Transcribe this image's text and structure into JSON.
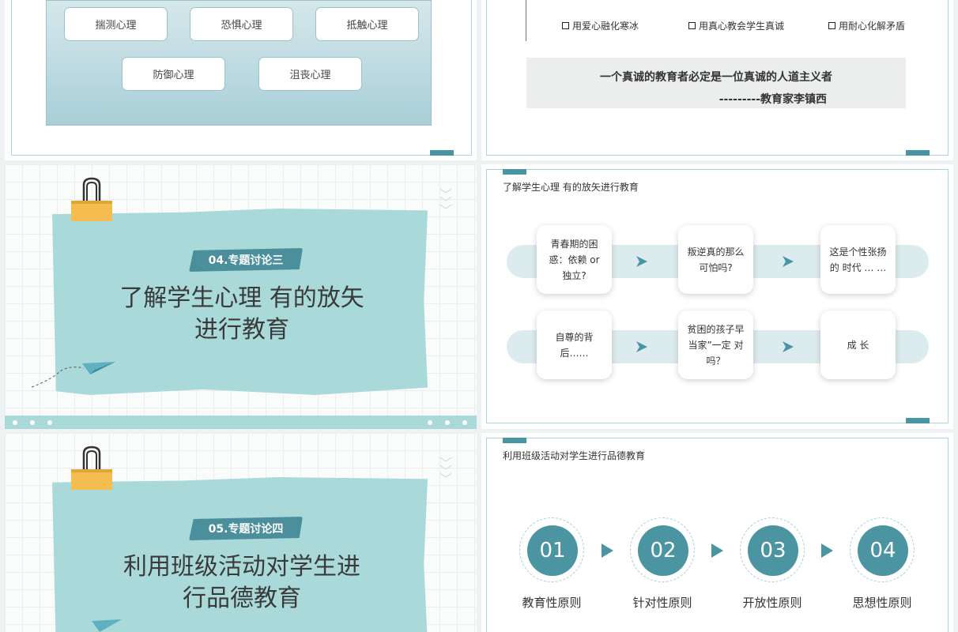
{
  "slide1": {
    "pills": [
      "揣测心理",
      "恐惧心理",
      "抵触心理",
      "防御心理",
      "沮丧心理"
    ]
  },
  "slide2": {
    "checks": [
      "用爱心融化寒冰",
      "用真心教会学生真诚",
      "用耐心化解矛盾"
    ],
    "quote_line1": "一个真诚的教育者必定是一位真诚的人道主义者",
    "quote_line2": "---------教育家李镇西"
  },
  "slide3": {
    "badge": "04.专题讨论三",
    "title_line1": "了解学生心理 有的放矢",
    "title_line2": "进行教育"
  },
  "slide4": {
    "label": "了解学生心理  有的放矢进行教育",
    "cards": [
      "青春期的困惑：依赖 or 独立?",
      "叛逆真的那么可怕吗?",
      "这是个性张扬 的 时代  …  …",
      "自尊的背后……",
      "贫困的孩子早当家”一定 对 吗？",
      "成  长"
    ]
  },
  "slide5": {
    "badge": "05.专题讨论四",
    "title_line1": "利用班级活动对学生进",
    "title_line2": "行品德教育"
  },
  "slide6": {
    "label": "利用班级活动对学生进行品德教育",
    "steps": [
      {
        "num": "01",
        "text": "教育性原则"
      },
      {
        "num": "02",
        "text": "针对性原则"
      },
      {
        "num": "03",
        "text": "开放性原则"
      },
      {
        "num": "04",
        "text": "思想性原则"
      }
    ]
  },
  "colors": {
    "teal": "#4a95a4",
    "light_teal": "#a9d9d9"
  }
}
